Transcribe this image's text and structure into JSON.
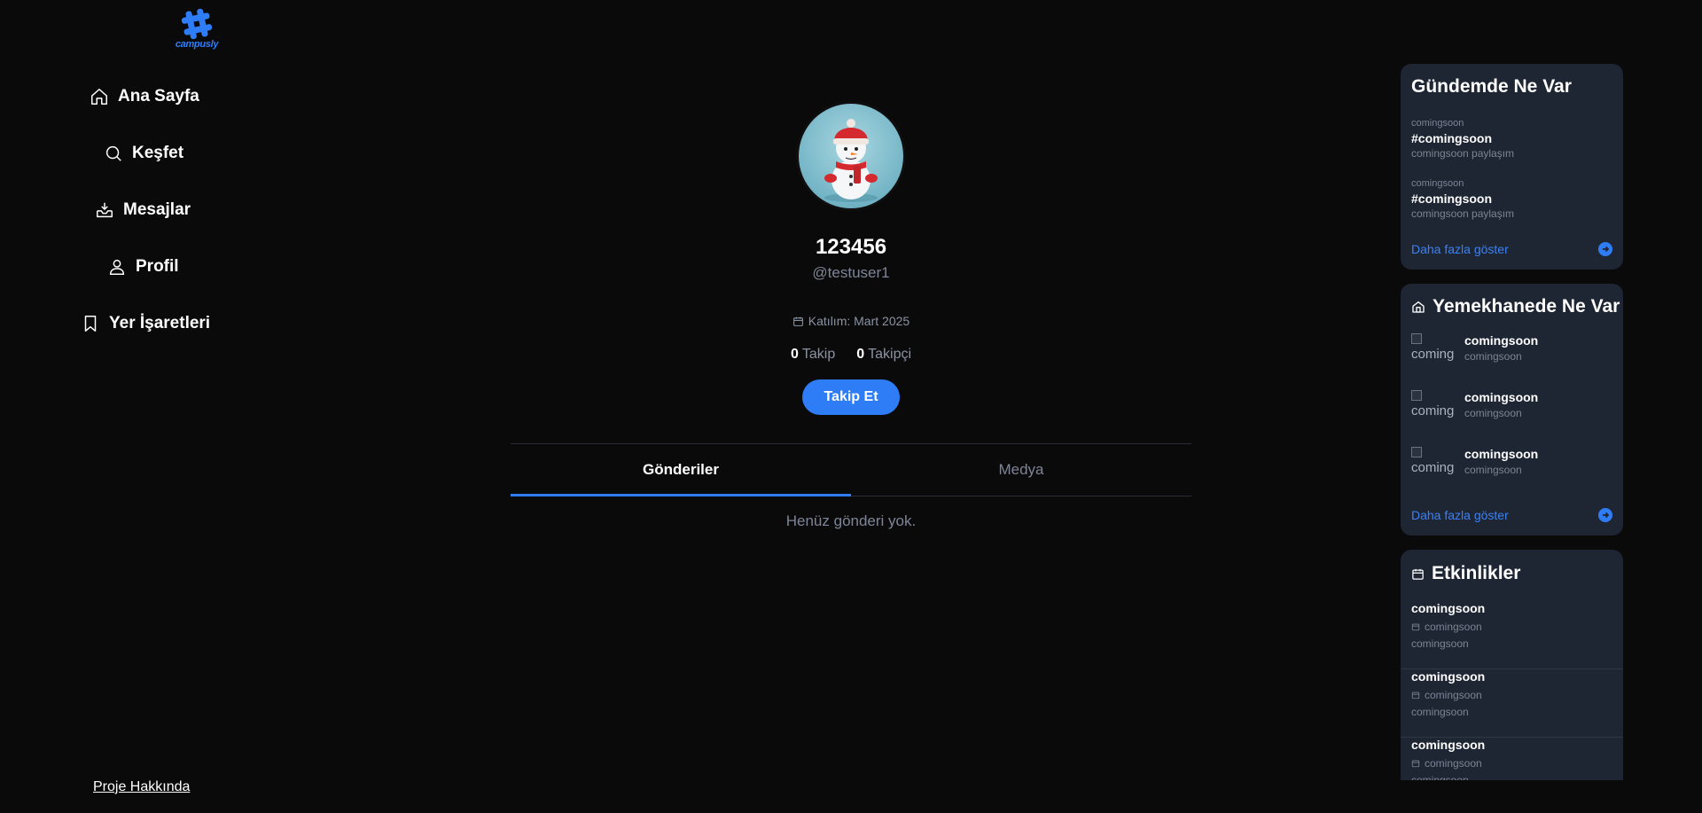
{
  "brand": {
    "logo_text": "campusly",
    "accent": "#2f7df6"
  },
  "nav": {
    "items": [
      {
        "label": "Ana Sayfa",
        "icon": "home-icon"
      },
      {
        "label": "Keşfet",
        "icon": "search-icon"
      },
      {
        "label": "Mesajlar",
        "icon": "inbox-icon"
      },
      {
        "label": "Profil",
        "icon": "user-icon"
      },
      {
        "label": "Yer İşaretleri",
        "icon": "bookmark-icon"
      }
    ],
    "footer_link": "Proje Hakkında"
  },
  "profile": {
    "display_name": "123456",
    "handle": "@testuser1",
    "joined": "Katılım: Mart 2025",
    "following_count": "0",
    "following_label": "Takip",
    "followers_count": "0",
    "followers_label": "Takipçi",
    "follow_button": "Takip Et",
    "tabs": [
      {
        "label": "Gönderiler",
        "active": true
      },
      {
        "label": "Medya",
        "active": false
      }
    ],
    "empty_message": "Henüz gönderi yok."
  },
  "trending": {
    "title": "Gündemde Ne Var",
    "items": [
      {
        "category": "comingsoon",
        "tag": "#comingsoon",
        "count": "comingsoon paylaşım"
      },
      {
        "category": "comingsoon",
        "tag": "#comingsoon",
        "count": "comingsoon paylaşım"
      }
    ],
    "more": "Daha fazla göster"
  },
  "cafeteria": {
    "title": "Yemekhanede Ne Var",
    "items": [
      {
        "thumb_alt": "coming",
        "name": "comingsoon",
        "sub": "comingsoon"
      },
      {
        "thumb_alt": "coming",
        "name": "comingsoon",
        "sub": "comingsoon"
      },
      {
        "thumb_alt": "coming",
        "name": "comingsoon",
        "sub": "comingsoon"
      }
    ],
    "more": "Daha fazla göster"
  },
  "events": {
    "title": "Etkinlikler",
    "items": [
      {
        "title": "comingsoon",
        "when": "comingsoon",
        "where": "comingsoon"
      },
      {
        "title": "comingsoon",
        "when": "comingsoon",
        "where": "comingsoon"
      },
      {
        "title": "comingsoon",
        "when": "comingsoon",
        "where": "comingsoon"
      }
    ]
  }
}
